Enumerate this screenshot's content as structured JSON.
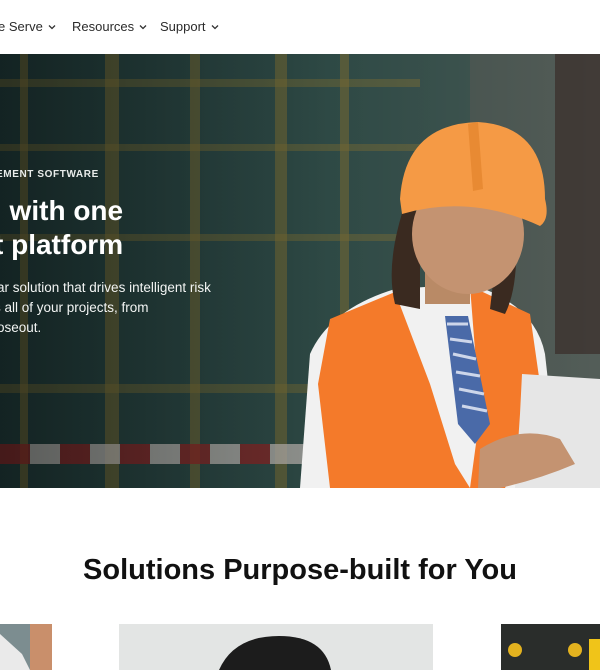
{
  "nav": {
    "items": [
      {
        "label": "e Serve"
      },
      {
        "label": "Resources"
      },
      {
        "label": "Support"
      }
    ]
  },
  "hero": {
    "eyebrow": "EMENT SOFTWARE",
    "headline_line1": "l with one",
    "headline_line2": "t platform",
    "body_line1": "lar solution that drives intelligent risk",
    "body_line2": "s all of your projects, from",
    "body_line3": "loseout.",
    "photo_description_icon": "construction-worker-photo"
  },
  "solutions": {
    "title": "Solutions Purpose-built for You"
  },
  "colors": {
    "hero_overlay": "#2d4b49",
    "vest_orange": "#f47a2a",
    "hardhat_orange": "#f59a45",
    "text_dark": "#111111"
  }
}
